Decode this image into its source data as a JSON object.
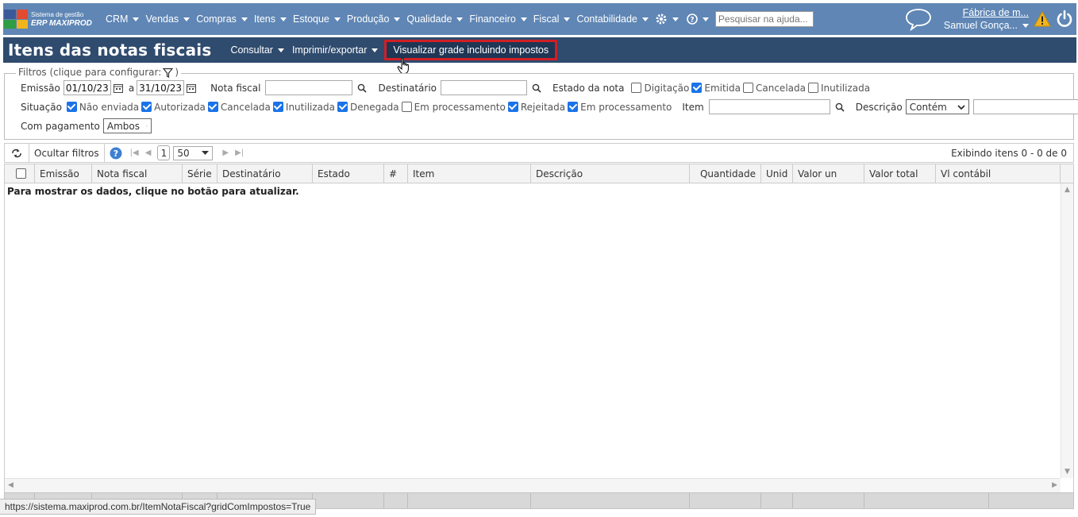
{
  "app": {
    "brand_line1": "Sistema de gestão",
    "brand_line2": "ERP MAXIPROD"
  },
  "nav": {
    "items": [
      "CRM",
      "Vendas",
      "Compras",
      "Itens",
      "Estoque",
      "Produção",
      "Qualidade",
      "Financeiro",
      "Fiscal",
      "Contabilidade"
    ],
    "help_search_placeholder": "Pesquisar na ajuda...",
    "company": "Fábrica de m...",
    "user": "Samuel Gonça..."
  },
  "titlebar": {
    "title": "Itens das notas fiscais",
    "consultar": "Consultar",
    "imprimir": "Imprimir/exportar",
    "visualizar": "Visualizar grade incluindo impostos"
  },
  "filters": {
    "legend": "Filtros (clique para configurar:",
    "legend_close": ")",
    "emissao_label": "Emissão",
    "date_from": "01/10/23",
    "date_sep": "a",
    "date_to": "31/10/23",
    "nota_label": "Nota fiscal",
    "dest_label": "Destinatário",
    "estado_label": "Estado da nota",
    "estado_opts": [
      {
        "label": "Digitação",
        "checked": false
      },
      {
        "label": "Emitida",
        "checked": true
      },
      {
        "label": "Cancelada",
        "checked": false
      },
      {
        "label": "Inutilizada",
        "checked": false
      }
    ],
    "situacao_label": "Situação",
    "situacao_opts": [
      {
        "label": "Não enviada",
        "checked": true
      },
      {
        "label": "Autorizada",
        "checked": true
      },
      {
        "label": "Cancelada",
        "checked": true
      },
      {
        "label": "Inutilizada",
        "checked": true
      },
      {
        "label": "Denegada",
        "checked": true
      },
      {
        "label": "Em processamento",
        "checked": false
      },
      {
        "label": "Rejeitada",
        "checked": true
      },
      {
        "label": "Em processamento",
        "checked": true
      }
    ],
    "item_label": "Item",
    "descricao_label": "Descrição",
    "descricao_mode": "Contém",
    "pagamento_label": "Com pagamento",
    "pagamento_value": "Ambos"
  },
  "grid": {
    "ocultar": "Ocultar filtros",
    "page": "1",
    "page_size": "50",
    "showing": "Exibindo itens 0 - 0 de 0",
    "columns": [
      "Emissão",
      "Nota fiscal",
      "Série",
      "Destinatário",
      "Estado",
      "#",
      "Item",
      "Descrição",
      "Quantidade",
      "Unid",
      "Valor un",
      "Valor total",
      "Vl contábil"
    ],
    "empty_message": "Para mostrar os dados, clique no botão para atualizar."
  },
  "status_url": "https://sistema.maxiprod.com.br/ItemNotaFiscal?gridComImpostos=True",
  "colors": {
    "nav_bg": "#5f86b5",
    "title_bg": "#2f4b6e",
    "highlight": "#d01f25",
    "check": "#1a73e8"
  }
}
